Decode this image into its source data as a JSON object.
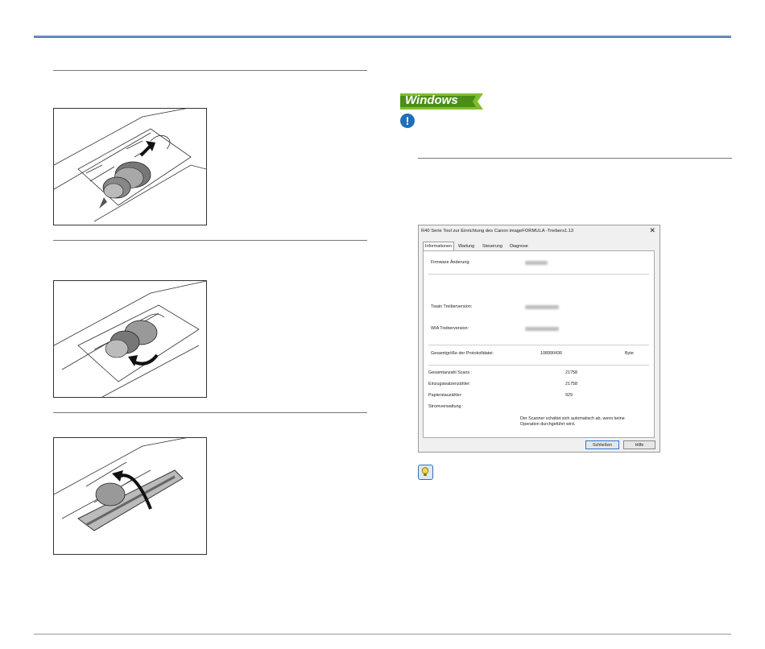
{
  "dialog": {
    "title": "R40 Serie Tool zur Einrichtung des Canon imageFORMULA -Treibers1.13",
    "close_glyph": "✕",
    "tabs": [
      "Informationen",
      "Wartung",
      "Steuerung",
      "Diagnose"
    ],
    "fields": {
      "firmware_label": "Firmware Änderung:",
      "twain_label": "Twain Treiberversion:",
      "wia_label": "WIA Treiberversion:",
      "logsize_label": "Gesamtgröße der Protokolldatei:",
      "logsize_value": "108990436",
      "logsize_unit": "Byte",
      "total_scans_label": "Gesamtanzahl Scans :",
      "total_scans_value": "21758",
      "feed_roller_label": "Einzugswalzenzähler:",
      "feed_roller_value": "21758",
      "paper_jam_label": "Papierstauzähler:",
      "paper_jam_value": "929",
      "power_label": "Stromverwaltung :",
      "power_text": "Der Scanner schaltet sich automatisch ab, wenn keine Operation durchgeführt wird."
    },
    "buttons": {
      "close": "Schließen",
      "help": "Hilfe"
    }
  },
  "badges": {
    "windows": "Windows",
    "warning_glyph": "!"
  },
  "icons": [
    "windows-logo-icon",
    "warning-icon",
    "hint-lightbulb-icon"
  ],
  "colors": {
    "header_line": "#2f5fa8",
    "windows_green": "#7fbf2a",
    "warning_blue": "#1f6fb6"
  }
}
